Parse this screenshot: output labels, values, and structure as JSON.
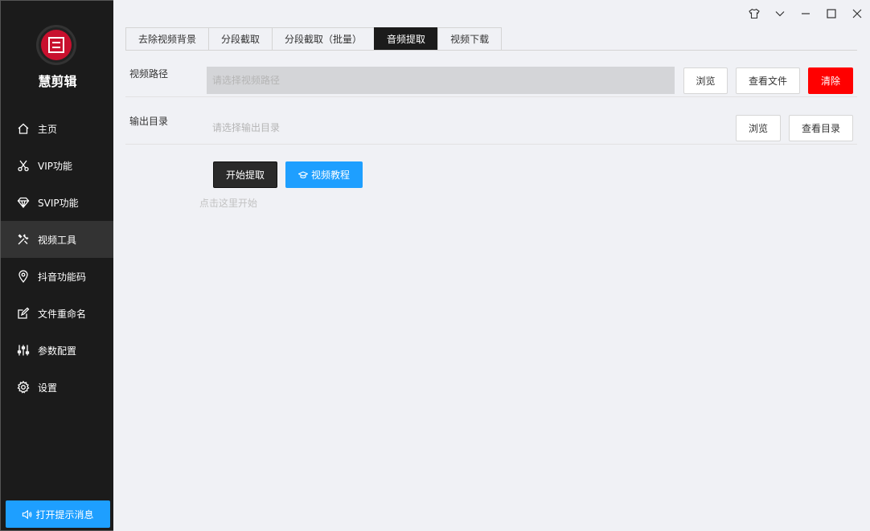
{
  "app": {
    "name": "慧剪辑"
  },
  "sidebar": {
    "items": [
      {
        "label": "主页",
        "icon": "home-icon",
        "active": false
      },
      {
        "label": "VIP功能",
        "icon": "scissors-icon",
        "active": false
      },
      {
        "label": "SVIP功能",
        "icon": "diamond-icon",
        "active": false
      },
      {
        "label": "视频工具",
        "icon": "tools-icon",
        "active": true
      },
      {
        "label": "抖音功能码",
        "icon": "location-pin-icon",
        "active": false
      },
      {
        "label": "文件重命名",
        "icon": "edit-icon",
        "active": false
      },
      {
        "label": "参数配置",
        "icon": "sliders-icon",
        "active": false
      },
      {
        "label": "设置",
        "icon": "gear-icon",
        "active": false
      }
    ],
    "notify_button": "打开提示消息"
  },
  "window_controls": [
    "skin-icon",
    "dropdown-icon",
    "minimize-icon",
    "maximize-icon",
    "close-icon"
  ],
  "tabs": [
    {
      "label": "去除视频背景",
      "active": false
    },
    {
      "label": "分段截取",
      "active": false
    },
    {
      "label": "分段截取（批量）",
      "active": false
    },
    {
      "label": "音频提取",
      "active": true
    },
    {
      "label": "视频下载",
      "active": false
    }
  ],
  "form": {
    "video_path": {
      "label": "视频路径",
      "placeholder": "请选择视频路径",
      "value": "",
      "browse": "浏览",
      "view": "查看文件",
      "clear": "清除"
    },
    "output_dir": {
      "label": "输出目录",
      "placeholder": "请选择输出目录",
      "value": "",
      "browse": "浏览",
      "view": "查看目录"
    }
  },
  "actions": {
    "start": "开始提取",
    "tutorial": "视频教程",
    "hint": "点击这里开始"
  },
  "colors": {
    "sidebar_bg": "#1b1b1b",
    "accent_blue": "#1e9fff",
    "danger_red": "#ff0000",
    "content_bg": "#f0f1f5"
  }
}
